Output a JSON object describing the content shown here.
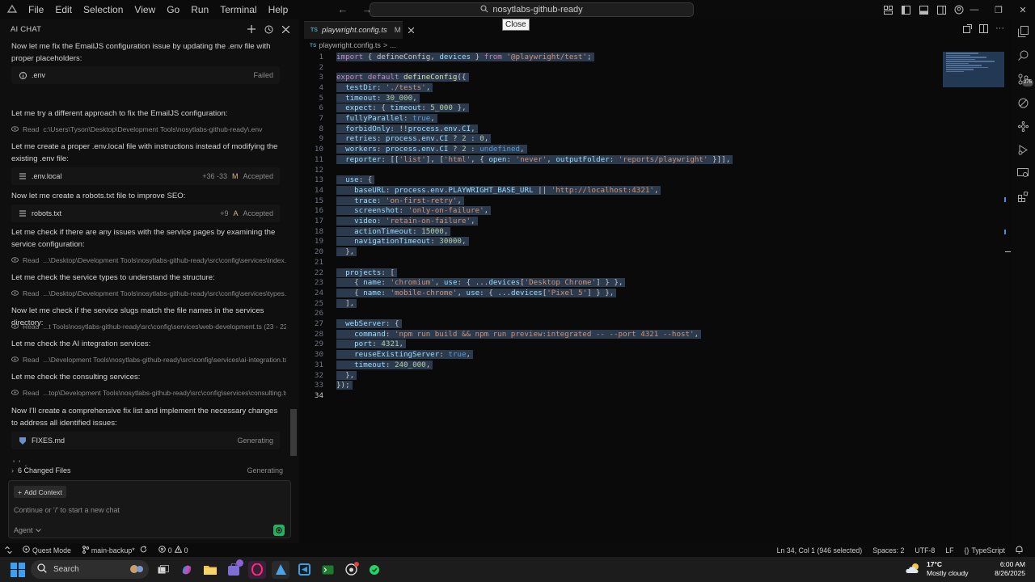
{
  "menubar": [
    "File",
    "Edit",
    "Selection",
    "View",
    "Go",
    "Run",
    "Terminal",
    "Help"
  ],
  "search": {
    "text": "nosytlabs-github-ready"
  },
  "tooltip": "Close",
  "chat": {
    "title": "AI CHAT",
    "messages": [
      {
        "kind": "text",
        "text": "Now let me fix the EmailJS configuration issue by updating the .env file with proper placeholders:"
      },
      {
        "kind": "file",
        "icon": "info-icon",
        "name": ".env",
        "status": "Failed"
      },
      {
        "kind": "text",
        "text": "Let me try a different approach to fix the EmailJS configuration:"
      },
      {
        "kind": "read",
        "label": "Read",
        "path": "c:\\Users\\Tyson\\Desktop\\Development Tools\\nosytlabs-github-ready\\.env"
      },
      {
        "kind": "text",
        "text": "Let me create a proper .env.local file with instructions instead of modifying the existing .env file:"
      },
      {
        "kind": "file",
        "icon": "list-file-icon",
        "name": ".env.local",
        "diff": "+36 -33",
        "mark": "M",
        "status": "Accepted"
      },
      {
        "kind": "text",
        "text": "Now let me create a robots.txt file to improve SEO:"
      },
      {
        "kind": "file",
        "icon": "list-file-icon",
        "name": "robots.txt",
        "diff": "+9",
        "mark": "A",
        "status": "Accepted"
      },
      {
        "kind": "text",
        "text": "Let me check if there are any issues with the service pages by examining the service configuration:"
      },
      {
        "kind": "read",
        "label": "Read",
        "path": "...\\Desktop\\Development Tools\\nosytlabs-github-ready\\src\\config\\services\\index.ts"
      },
      {
        "kind": "text",
        "text": "Let me check the service types to understand the structure:"
      },
      {
        "kind": "read",
        "label": "Read",
        "path": "...\\Desktop\\Development Tools\\nosytlabs-github-ready\\src\\config\\services\\types.ts"
      },
      {
        "kind": "text",
        "text": "Now let me check if the service slugs match the file names in the services directory:"
      },
      {
        "kind": "read",
        "label": "Read",
        "path": "...t Tools\\nosytlabs-github-ready\\src\\config\\services\\web-development.ts (23 - 222)"
      },
      {
        "kind": "text",
        "text": "Let me check the AI integration services:"
      },
      {
        "kind": "read",
        "label": "Read",
        "path": "...\\Development Tools\\nosytlabs-github-ready\\src\\config\\services\\ai-integration.ts"
      },
      {
        "kind": "text",
        "text": "Let me check the consulting services:"
      },
      {
        "kind": "read",
        "label": "Read",
        "path": "...top\\Development Tools\\nosytlabs-github-ready\\src\\config\\services\\consulting.ts"
      },
      {
        "kind": "text",
        "text": "Now I'll create a comprehensive fix list and implement the necessary changes to address all identified issues:"
      },
      {
        "kind": "file",
        "icon": "markdown-icon",
        "name": "FIXES.md",
        "status": "Generating"
      }
    ],
    "typing": "' ' .",
    "changed_files": {
      "label": "6 Changed Files",
      "status": "Generating"
    },
    "add_context": "Add Context",
    "input_placeholder": "Continue or '/' to start a new chat",
    "agent": "Agent"
  },
  "editor": {
    "tab": {
      "lang": "TS",
      "name": "playwright.config.ts",
      "mark": "M"
    },
    "breadcrumb": {
      "lang": "TS",
      "file": "playwright.config.ts",
      "sep": ">",
      "more": "..."
    },
    "code": [
      "import { defineConfig, devices } from '@playwright/test';",
      "",
      "export default defineConfig({",
      "  testDir: './tests',",
      "  timeout: 30_000,",
      "  expect: { timeout: 5_000 },",
      "  fullyParallel: true,",
      "  forbidOnly: !!process.env.CI,",
      "  retries: process.env.CI ? 2 : 0,",
      "  workers: process.env.CI ? 2 : undefined,",
      "  reporter: [['list'], ['html', { open: 'never', outputFolder: 'reports/playwright' }]],",
      "",
      "  use: {",
      "    baseURL: process.env.PLAYWRIGHT_BASE_URL || 'http://localhost:4321',",
      "    trace: 'on-first-retry',",
      "    screenshot: 'only-on-failure',",
      "    video: 'retain-on-failure',",
      "    actionTimeout: 15000,",
      "    navigationTimeout: 30000,",
      "  },",
      "",
      "  projects: [",
      "    { name: 'chromium', use: { ...devices['Desktop Chrome'] } },",
      "    { name: 'mobile-chrome', use: { ...devices['Pixel 5'] } },",
      "  ],",
      "",
      "  webServer: {",
      "    command: 'npm run build && npm run preview:integrated -- --port 4321 --host',",
      "    port: 4321,",
      "    reuseExistingServer: true,",
      "    timeout: 240_000,",
      "  },",
      "});",
      ""
    ],
    "active_line": 34
  },
  "activity": {
    "badge": "275"
  },
  "status": {
    "mode": "Quest Mode",
    "branch": "main-backup*",
    "problems": "0",
    "warnings": "0",
    "cursor": "Ln 34, Col 1 (946 selected)",
    "spaces": "Spaces: 2",
    "encoding": "UTF-8",
    "eol": "LF",
    "language": "TypeScript"
  },
  "taskbar": {
    "search": "Search",
    "weather": {
      "temp": "17°C",
      "desc": "Mostly cloudy"
    },
    "time": "6:00 AM",
    "date": "8/26/2025"
  },
  "colors": {
    "accent": "#27ae60",
    "selection": "#2c3a4d",
    "start": "#3aa0f3"
  }
}
